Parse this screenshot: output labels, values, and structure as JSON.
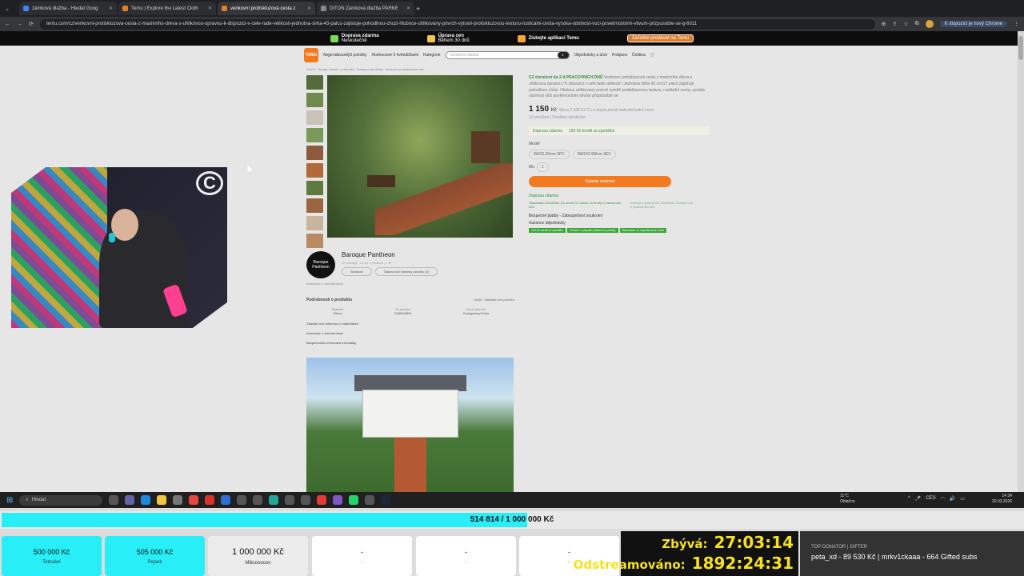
{
  "browser": {
    "tabs": [
      {
        "title": "zámková dlažba - Hledat Goog",
        "active": false
      },
      {
        "title": "Temu | Explore the Latest Cloth",
        "active": false
      },
      {
        "title": "venkovní protiskluzová cesta z",
        "active": true
      },
      {
        "title": "DITON Zámková dlažba PARKE",
        "active": false
      }
    ],
    "url": "temu.com/cz/venkovni-protiskluzova-cesta-z-masivniho-dreva-s-uhlikovou-opravou-k-dispozici-v-cele-rade-velikosti-jednotna-sirka-43-palcu-zajistuje-pohodlnou-chuzi-hluboce-uhlikovany-povrch-vytvari-protiskluzovou-texturu-rusticalni-cesta-vysoka-odolnost-vuci-povetrnostnim-vlivum-prizpusobte-se-g-6011",
    "chrome_badge": "K dispozici je nový Chrome"
  },
  "temu": {
    "promo": {
      "shipping": "Doprava zdarma",
      "shipping_sub": "Neskutečně",
      "refund": "Úprava cen",
      "refund_sub": "Během 30 dnů",
      "app": "Získejte aplikaci Temu",
      "shortcut": "Začněte prodávat na Temu"
    },
    "nav": {
      "logo": "TEMU",
      "bestsellers": "Nejprodávanější položky",
      "rated": "Hodnocené 5 hvězdičkami",
      "categories": "Kategorie",
      "search_placeholder": "venkovní dlažba",
      "orders": "Objednávky a účet",
      "support": "Podpora",
      "lang": "Čeština"
    },
    "breadcrumb": "Domů  ›  Terasa, trávník a zahrada  ›  Terasy a chodníky  ›  Venkovní protiskluzová ces...",
    "product": {
      "delivery_note": "CZ doručení do 2-4 PRACOVNÍCH DNŮ",
      "description": "Venkovní protiskluzová cesta z masivního dřeva s uhlíkovou úpravou / K dispozici v celé řadě velikostí / Jednotná šířka 43 cm/17 palců zajišťuje pohodlnou chůzi. Hluboce uhlíkovaný povrch vytváří protiskluzovou texturu, rustikální cesta, vysoká odolnost vůči povětrnostním vlivům přizpůsobte se",
      "price": "1 150",
      "currency": "Kč",
      "price_note": "Sleva 2 000 Kč Cz a doporučená maloobchodní cena",
      "sold": "10 prodáno",
      "seller_label": "Prodává výrobcům",
      "ship_free": "Doprava zdarma",
      "credit": "100 Kč kredit za zpoždění",
      "model_label": "Model",
      "models": [
        "8W23.3Dnm 5PC",
        "8W243.9Mcm 3KS"
      ],
      "qty_label": "Mn.",
      "qty": "1",
      "buy_label": "Vyberte možnost",
      "shipping_title": "Doprava zdarma",
      "shipping_note": "Standardní ZDARMA: Do země CZ doručí za hrubý 2 pracovních dnů",
      "express_note": "Křenují a výnimečné ZDARMA: Doručení do 4 pracovních dnů",
      "secure": "Bezpečné platby - Zabezpečení soukromí",
      "guarantee": "Garance objednávky",
      "guarantee_tags": [
        "100 Kč kredit za zpoždění",
        "Vrácení v případě poškození položky",
        "Refundace za nepoškozené zboží"
      ]
    },
    "seller": {
      "name": "Baroque Pantheon",
      "logo_text": "Baroque Pantheon",
      "stats": "30 prodejů  |  1,1 tis.+ prodáno  |  1 ★",
      "follow": "Sledovat",
      "show_all": "Takzpozvat všechny položky (3)",
      "more": "Informace o obchodníkovi"
    },
    "details": {
      "title": "Podrobnosti o produktu",
      "save": "Uložit",
      "report": "Nahlásit tuto položku",
      "material_label": "Materiál",
      "material": "Dřevo",
      "id_label": "ID položky",
      "id": "KQ6526894",
      "origin_label": "Země původu",
      "origin": "Guangdong,China",
      "link1": "Získejte více informací o materiálech",
      "link2": "Informace o obchodníkovi",
      "link3": "Bezpečnostní informace a kontakty"
    }
  },
  "taskbar": {
    "search": "Hledat",
    "temp": "11°C",
    "weather": "Oblačno",
    "lang": "CES",
    "time": "14:34",
    "date": "20.03.2026"
  },
  "overlay": {
    "progress_text": "514 814 / 1 000 000 Kč",
    "progress_fraction": 0.5148,
    "goals": [
      {
        "value": "500 000 Kč",
        "label": "Tetování"
      },
      {
        "value": "505 000 Kč",
        "label": "Pejsek"
      },
      {
        "value": "1 000 000 Kč",
        "label": "Milioooooon"
      },
      {
        "value": "-",
        "label": "-"
      },
      {
        "value": "-",
        "label": "-"
      },
      {
        "value": "-",
        "label": "-"
      }
    ],
    "remaining_label": "Zbývá:",
    "remaining_value": "27:03:14",
    "streamed_label": "Odstreamováno:",
    "streamed_value": "1892:24:31",
    "donor_title": "TOP DONATOR | GIFTER",
    "donor_text": "peta_xd - 89 530 Kč | mrkv1ckaaa - 664 Gifted subs"
  },
  "colors": {
    "accent_cyan": "#27eef7",
    "temu_orange": "#f47a20",
    "timer_yellow": "#f7e11d"
  }
}
